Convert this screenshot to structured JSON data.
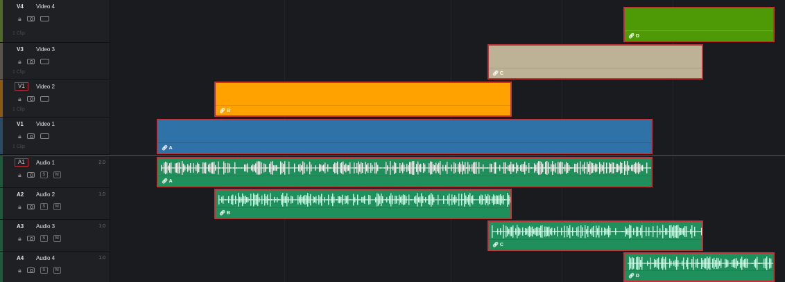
{
  "video_tracks": [
    {
      "id": "V4",
      "name": "Video 4",
      "clip_count": "1 Clip",
      "stripe": "#4d6a26",
      "id_boxed": false
    },
    {
      "id": "V3",
      "name": "Video 3",
      "clip_count": "1 Clip",
      "stripe": "#5a5448",
      "id_boxed": false
    },
    {
      "id": "V1",
      "name": "Video 2",
      "clip_count": "1 Clip",
      "stripe": "#8a5a12",
      "id_boxed": true
    },
    {
      "id": "V1",
      "name": "Video 1",
      "clip_count": "1 Clip",
      "stripe": "#2c4a66",
      "id_boxed": false
    }
  ],
  "audio_tracks": [
    {
      "id": "A1",
      "name": "Audio 1",
      "level": "2.0",
      "stripe": "#1c5a3a",
      "id_boxed": true
    },
    {
      "id": "A2",
      "name": "Audio 2",
      "level": "1.0",
      "stripe": "#1c5a3a",
      "id_boxed": false
    },
    {
      "id": "A3",
      "name": "Audio 3",
      "level": "1.0",
      "stripe": "#1c5a3a",
      "id_boxed": false
    },
    {
      "id": "A4",
      "name": "Audio 4",
      "level": "1.0",
      "stripe": "#1c5a3a",
      "id_boxed": false
    }
  ],
  "audio_buttons": {
    "solo": "S",
    "mute": "M"
  },
  "clips": [
    {
      "track": "V4",
      "label": "D",
      "color": "#4e9a06",
      "line": "#8fd83a"
    },
    {
      "track": "V3",
      "label": "C",
      "color": "#bdb296",
      "line": "#8c8470"
    },
    {
      "track": "V2",
      "label": "B",
      "color": "#ffa200",
      "line": "#c47a00"
    },
    {
      "track": "V1",
      "label": "A",
      "color": "#2f72a8",
      "line": "#1d4c72"
    },
    {
      "track": "A1",
      "label": "A",
      "color": "#1f8f5b",
      "line": "#137044"
    },
    {
      "track": "A2",
      "label": "B",
      "color": "#1f8f5b",
      "line": "#137044"
    },
    {
      "track": "A3",
      "label": "C",
      "color": "#1f8f5b",
      "line": "#137044"
    },
    {
      "track": "A4",
      "label": "D",
      "color": "#1f8f5b",
      "line": "#137044"
    }
  ],
  "colors": {
    "selection_border": "#c3343a",
    "waveform": "#e6f5ec"
  }
}
